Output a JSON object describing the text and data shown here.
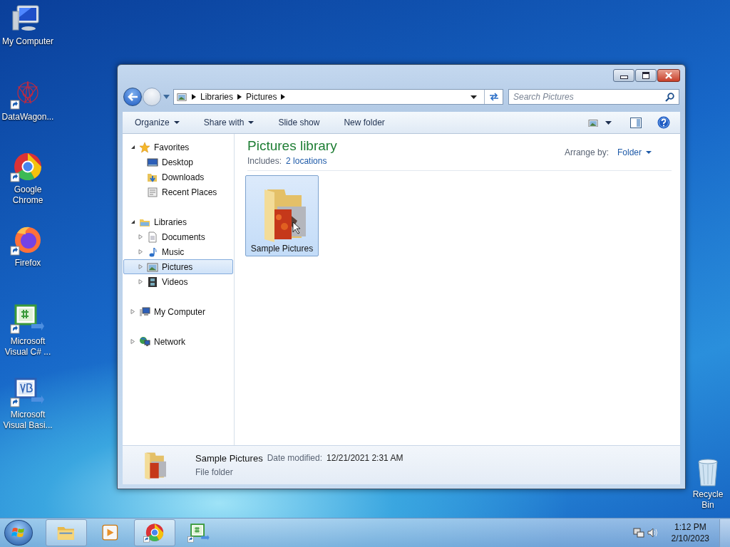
{
  "desktop_icons": [
    {
      "label": "My Computer",
      "kind": "computer"
    },
    {
      "label": "DataWagon...",
      "kind": "datawagon"
    },
    {
      "label": "Google Chrome",
      "kind": "chrome"
    },
    {
      "label": "Firefox",
      "kind": "firefox"
    },
    {
      "label": "Microsoft Visual C# ...",
      "kind": "csharp"
    },
    {
      "label": "Microsoft Visual Basi...",
      "kind": "vb"
    }
  ],
  "recycle_bin": {
    "label": "Recycle Bin",
    "kind": "bin"
  },
  "explorer": {
    "breadcrumbs": [
      "Libraries",
      "Pictures"
    ],
    "search": {
      "placeholder": "Search Pictures"
    },
    "toolbar": [
      {
        "label": "Organize",
        "dropdown": true
      },
      {
        "label": "Share with",
        "dropdown": true
      },
      {
        "label": "Slide show",
        "dropdown": false
      },
      {
        "label": "New folder",
        "dropdown": false
      }
    ],
    "nav": [
      {
        "label": "Favorites",
        "kind": "star",
        "expanded": true,
        "children": [
          {
            "label": "Desktop",
            "kind": "desktop",
            "selected": false
          },
          {
            "label": "Downloads",
            "kind": "downloads",
            "selected": false
          },
          {
            "label": "Recent Places",
            "kind": "recent",
            "selected": false
          }
        ]
      },
      {
        "label": "Libraries",
        "kind": "libraries",
        "expanded": true,
        "children": [
          {
            "label": "Documents",
            "kind": "documents",
            "selected": false,
            "expanded": false
          },
          {
            "label": "Music",
            "kind": "music",
            "selected": false,
            "expanded": false
          },
          {
            "label": "Pictures",
            "kind": "pictures",
            "selected": true,
            "expanded": false
          },
          {
            "label": "Videos",
            "kind": "videos",
            "selected": false,
            "expanded": false
          }
        ]
      },
      {
        "label": "My Computer",
        "kind": "computer",
        "expanded": false
      },
      {
        "label": "Network",
        "kind": "network",
        "expanded": false
      }
    ],
    "library": {
      "title": "Pictures library",
      "includes_label": "Includes:",
      "includes_link": "2 locations",
      "arrange_label": "Arrange by:",
      "arrange_value": "Folder"
    },
    "items": [
      {
        "label": "Sample Pictures",
        "selected": true
      }
    ],
    "details": {
      "name": "Sample Pictures",
      "date_label": "Date modified:",
      "date": "12/21/2021 2:31 AM",
      "type": "File folder"
    }
  },
  "taskbar": {
    "buttons": [
      {
        "kind": "explorer",
        "running": true
      },
      {
        "kind": "media",
        "running": false
      },
      {
        "kind": "chrome",
        "running": true
      },
      {
        "kind": "csharp",
        "running": false
      }
    ],
    "time": "1:12 PM",
    "date": "2/10/2023"
  }
}
